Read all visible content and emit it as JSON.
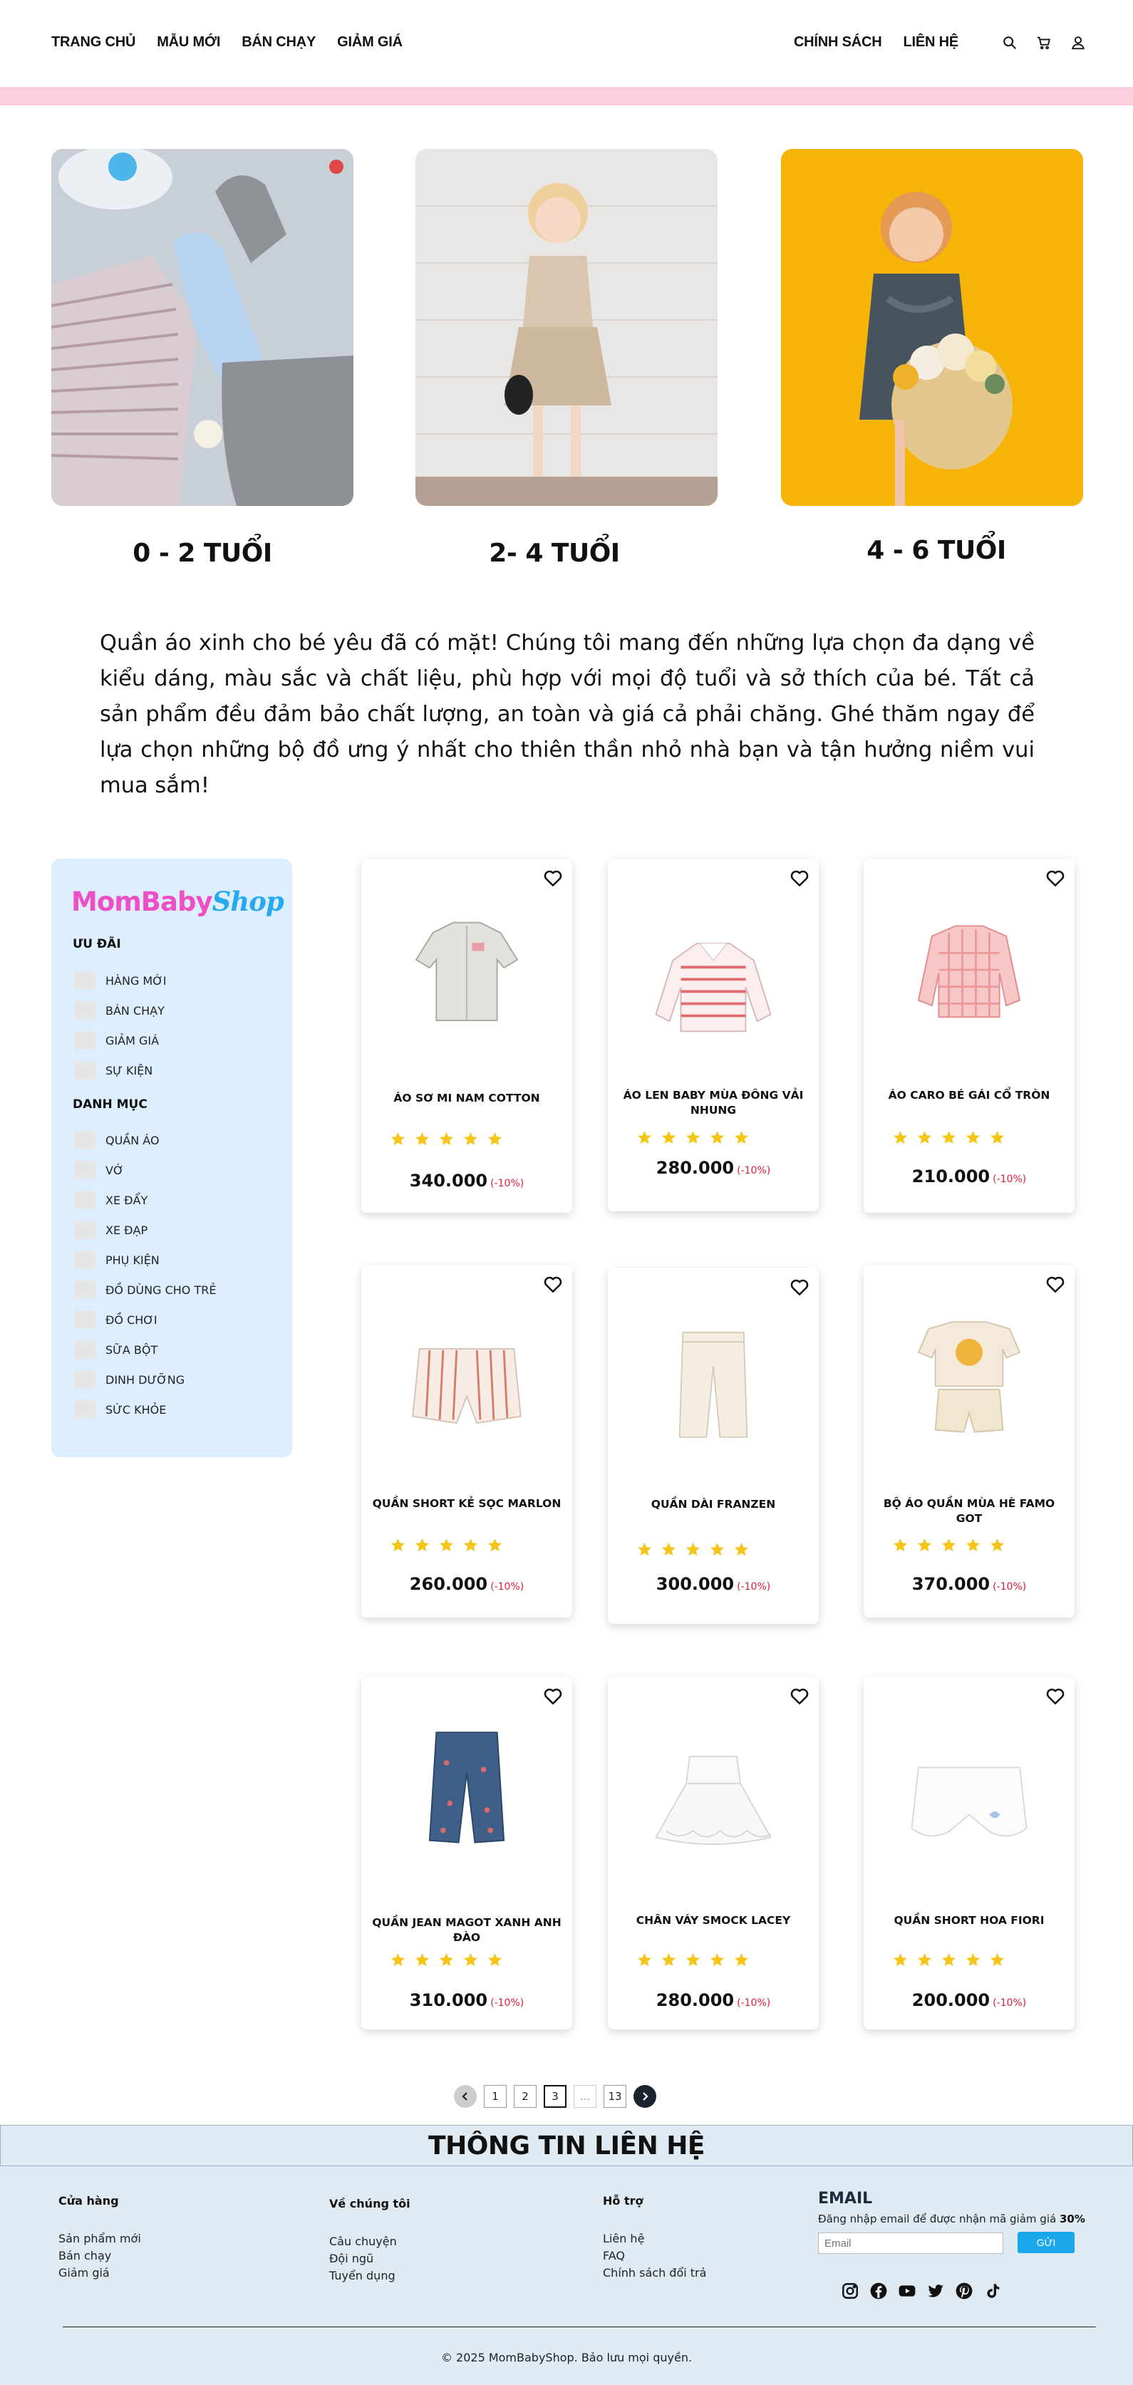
{
  "header": {
    "nav_left": [
      "TRANG CHỦ",
      "MẪU MỚI",
      "BÁN CHẠY",
      "GIẢM GIÁ"
    ],
    "nav_right": [
      "CHÍNH SÁCH",
      "LIÊN HỆ"
    ],
    "icons": [
      "search-icon",
      "cart-icon",
      "user-icon"
    ]
  },
  "colors": {
    "pink_bar": "#fdcfe0",
    "sidebar_bg": "#ddeeff",
    "logo_pink": "#ee4fc7",
    "logo_blue": "#27a9f0",
    "star": "#f5c518",
    "discount": "#e11d3b",
    "footer_bg": "#dfeaf3",
    "subscribe_button": "#1aa7ec"
  },
  "age_groups": [
    {
      "label": "0 - 2 TUỔI"
    },
    {
      "label": "2- 4 TUỔI"
    },
    {
      "label": "4 - 6 TUỔI"
    }
  ],
  "intro": "Quần áo xinh cho bé yêu đã có mặt! Chúng tôi mang đến những lựa chọn đa dạng về kiểu dáng, màu sắc và chất liệu, phù hợp với mọi độ tuổi và sở thích của bé. Tất cả sản phẩm đều đảm bảo chất lượng, an toàn và giá cả phải chăng. Ghé thăm ngay để lựa chọn những bộ đồ ưng ý nhất cho thiên thần nhỏ nhà bạn và tận hưởng niềm vui mua sắm!",
  "sidebar": {
    "logo_part1": "MomBaby",
    "logo_part2": "Shop",
    "offers_title": "ƯU ĐÃI",
    "offers": [
      "HÀNG MỚI",
      "BÁN CHẠY",
      "GIẢM GIÁ",
      "SỰ KIỆN"
    ],
    "category_title": "DANH MỤC",
    "categories": [
      "QUẦN ÁO",
      "VỚ",
      "XE ĐẨY",
      "XE ĐẠP",
      "PHỤ KIỆN",
      "ĐỒ DÙNG CHO TRẺ",
      "ĐỒ CHƠI",
      "SỮA BỘT",
      "DINH DƯỠNG",
      "SỨC KHỎE"
    ]
  },
  "products": [
    {
      "name": "ÁO SƠ MI NAM COTTON",
      "price": "340.000",
      "discount": "(-10%)",
      "rating": 5
    },
    {
      "name": "ÁO LEN BABY MÙA ĐÔNG VẢI NHUNG",
      "price": "280.000",
      "discount": "(-10%)",
      "rating": 5
    },
    {
      "name": "ÁO CARO BÉ GÁI CỔ TRÒN",
      "price": "210.000",
      "discount": "(-10%)",
      "rating": 5
    },
    {
      "name": "QUẦN SHORT KẺ SỌC MARLON",
      "price": "260.000",
      "discount": "(-10%)",
      "rating": 5
    },
    {
      "name": "QUẦN DÀI FRANZEN",
      "price": "300.000",
      "discount": "(-10%)",
      "rating": 5
    },
    {
      "name": "BỘ ÁO QUẦN MÙA HÈ FAMO GOT",
      "price": "370.000",
      "discount": "(-10%)",
      "rating": 5
    },
    {
      "name": "QUẦN JEAN MAGOT XANH ANH ĐÀO",
      "price": "310.000",
      "discount": "(-10%)",
      "rating": 5
    },
    {
      "name": "CHÂN VÁY SMOCK LACEY",
      "price": "280.000",
      "discount": "(-10%)",
      "rating": 5
    },
    {
      "name": "QUẦN SHORT HOA FIORI",
      "price": "200.000",
      "discount": "(-10%)",
      "rating": 5
    }
  ],
  "pagination": {
    "pages": [
      "1",
      "2",
      "3",
      "...",
      "13"
    ],
    "current": "3"
  },
  "footer": {
    "title": "THÔNG TIN LIÊN HỆ",
    "columns": [
      {
        "title": "Cửa hàng",
        "links": [
          "Sản phẩm mới",
          "Bán chạy",
          "Giảm giá"
        ]
      },
      {
        "title": "Về chúng tôi",
        "links": [
          "Câu chuyện",
          "Đội ngũ",
          "Tuyển dụng"
        ]
      },
      {
        "title": "Hỗ trợ",
        "links": [
          "Liên hệ",
          "FAQ",
          "Chính sách đổi trả"
        ]
      }
    ],
    "email_title": "EMAIL",
    "email_sub": "Đăng nhập email để được nhận mã giảm giá",
    "email_discount": "30%",
    "email_placeholder": "Email",
    "email_button": "GỬI",
    "socials": [
      "instagram-icon",
      "facebook-icon",
      "youtube-icon",
      "twitter-icon",
      "pinterest-icon",
      "tiktok-icon"
    ],
    "copyright": "© 2025 MomBabyShop. Bảo lưu mọi quyền."
  }
}
